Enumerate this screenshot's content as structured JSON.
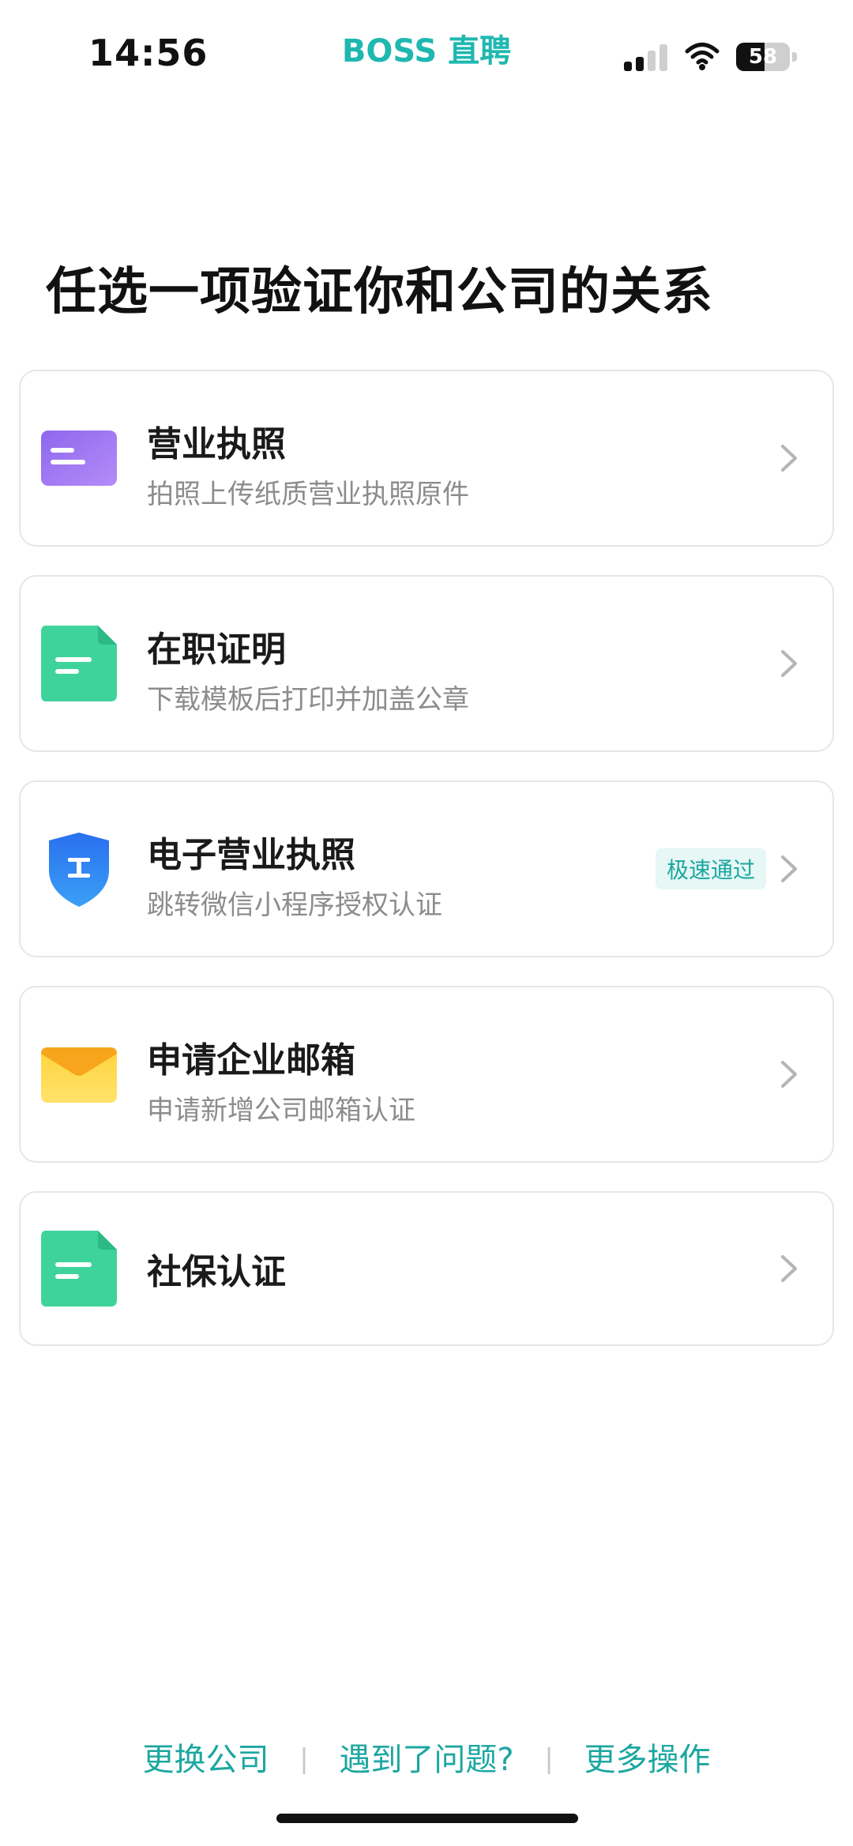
{
  "status_bar": {
    "time": "14:56",
    "brand": "BOSS 直聘",
    "battery": "58",
    "icons": [
      "signal-icon",
      "wifi-icon",
      "battery-icon"
    ]
  },
  "page": {
    "title": "任选一项验证你和公司的关系"
  },
  "options": [
    {
      "title": "营业执照",
      "subtitle": "拍照上传纸质营业执照原件",
      "icon": "business-license-icon",
      "icon_color": "#9b6ff2"
    },
    {
      "title": "在职证明",
      "subtitle": "下载模板后打印并加盖公章",
      "icon": "document-icon",
      "icon_color": "#3fd39c"
    },
    {
      "title": "电子营业执照",
      "subtitle": "跳转微信小程序授权认证",
      "badge": "极速通过",
      "icon": "shield-icon",
      "icon_color": "#2f7ef1"
    },
    {
      "title": "申请企业邮箱",
      "subtitle": "申请新增公司邮箱认证",
      "icon": "envelope-icon",
      "icon_color": "#ffc530"
    },
    {
      "title": "社保认证",
      "icon": "document-icon",
      "icon_color": "#3fd39c"
    }
  ],
  "footer": {
    "change_company": "更换公司",
    "problem": "遇到了问题?",
    "more": "更多操作"
  },
  "colors": {
    "accent": "#1ca7a0",
    "brand": "#1fb8b0"
  }
}
